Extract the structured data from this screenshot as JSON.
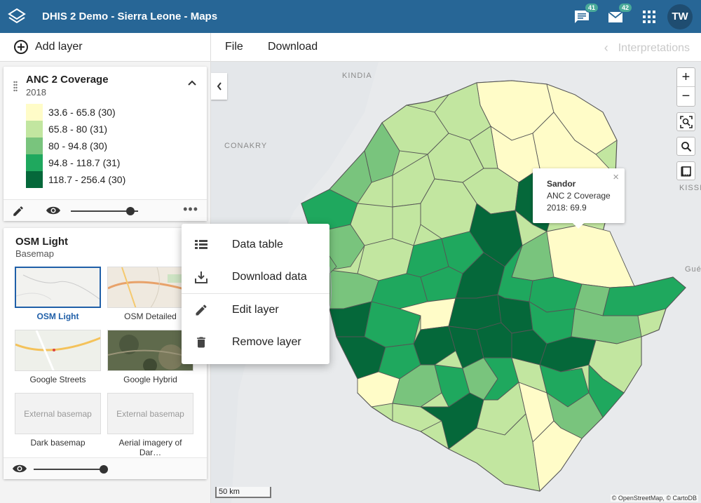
{
  "header": {
    "title": "DHIS 2 Demo - Sierra Leone - Maps",
    "messages_badge": "41",
    "mail_badge": "42",
    "avatar_initials": "TW",
    "bg_color": "#276696"
  },
  "toolbar": {
    "add_layer_label": "Add layer",
    "file_label": "File",
    "download_label": "Download",
    "interpretations_label": "Interpretations"
  },
  "layers": {
    "thematic": {
      "title": "ANC 2 Coverage",
      "period": "2018",
      "legend": [
        {
          "label": "33.6 - 65.8 (30)",
          "color": "#fffcc8"
        },
        {
          "label": "65.8 - 80 (31)",
          "color": "#c2e6a0"
        },
        {
          "label": "80 - 94.8 (30)",
          "color": "#79c47d"
        },
        {
          "label": "94.8 - 118.7 (31)",
          "color": "#1fa85e"
        },
        {
          "label": "118.7 - 256.4 (30)",
          "color": "#05683a"
        }
      ]
    },
    "basemap": {
      "title": "OSM Light",
      "subtitle": "Basemap",
      "options": [
        {
          "label": "OSM Light",
          "selected": true
        },
        {
          "label": "OSM Detailed",
          "selected": false
        },
        {
          "label": "Google Streets",
          "selected": false
        },
        {
          "label": "Google Hybrid",
          "selected": false
        },
        {
          "label": "Dark basemap",
          "selected": false,
          "placeholder": "External basemap"
        },
        {
          "label": "Aerial imagery of Dar…",
          "selected": false,
          "placeholder": "External basemap"
        }
      ]
    }
  },
  "context_menu": {
    "items": [
      {
        "label": "Data table",
        "icon": "table-icon"
      },
      {
        "label": "Download data",
        "icon": "download-icon"
      },
      {
        "label": "Edit layer",
        "icon": "pencil-icon"
      },
      {
        "label": "Remove layer",
        "icon": "trash-icon"
      }
    ]
  },
  "map": {
    "places": {
      "kindia": "KINDIA",
      "conakry": "CONAKRY",
      "kissi": "KISSI",
      "gueck": "Guéc"
    },
    "popup": {
      "name": "Sandor",
      "layer": "ANC 2 Coverage",
      "value": "2018: 69.9"
    },
    "scale_label": "50 km",
    "attribution": "© OpenStreetMap, © CartoDB"
  }
}
